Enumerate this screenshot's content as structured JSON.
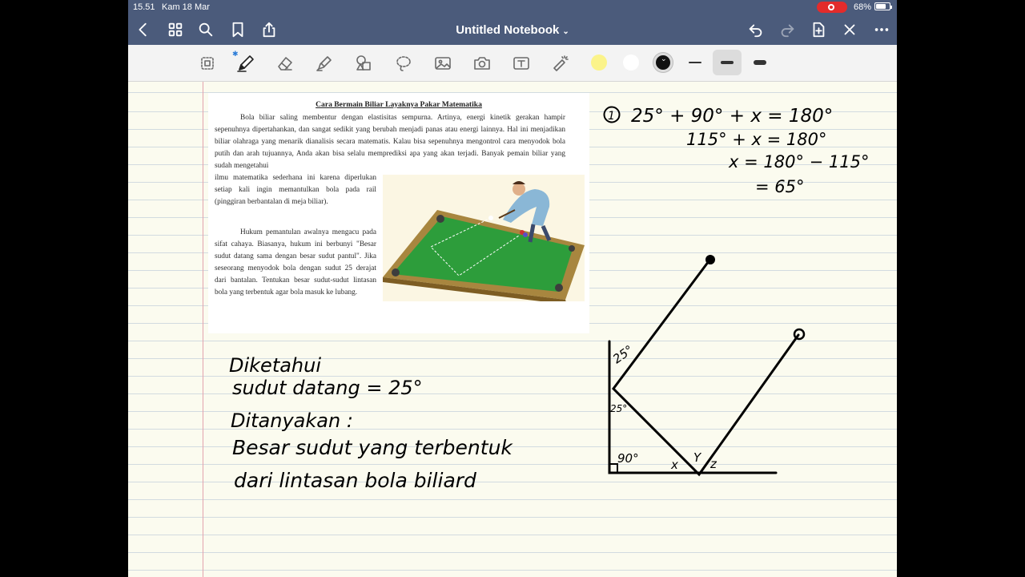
{
  "status_bar": {
    "time": "15.51",
    "date": "Kam 18 Mar",
    "battery": "68%"
  },
  "nav_bar": {
    "title": "Untitled Notebook",
    "title_chevron": "⌄"
  },
  "toolbar": {
    "tools": [
      "lasso-panel-icon",
      "pen-icon",
      "eraser-icon",
      "highlighter-icon",
      "shapes-icon",
      "lasso-icon",
      "image-icon",
      "camera-icon",
      "text-icon",
      "laser-pointer-icon"
    ],
    "colors": {
      "yellow": "#fbf38a",
      "white": "#ffffff",
      "black": "#111111"
    },
    "bluetooth": "✱"
  },
  "document_excerpt": {
    "title": "Cara Bermain Biliar Layaknya Pakar Matematika",
    "paragraph1": "Bola biliar saling membentur dengan elastisitas sempurna. Artinya, energi kinetik gerakan hampir sepenuhnya dipertahankan, dan sangat sedikit yang berubah menjadi panas atau energi lainnya. Hal ini menjadikan biliar olahraga yang menarik dianalisis secara matematis. Kalau bisa sepenuhnya mengontrol cara menyodok bola putih dan arah tujuannya, Anda akan bisa selalu memprediksi apa yang akan terjadi. Banyak pemain biliar yang sudah mengetahui",
    "paragraph2": "ilmu matematika sederhana ini karena diperlukan setiap kali ingin memantulkan bola pada rail (pinggiran berbantalan di meja biliar).",
    "paragraph3": "Hukum pemantulan awalnya mengacu pada sifat cahaya. Biasanya, hukum ini berbunyi \"Besar sudut datang sama dengan besar sudut pantul\". Jika seseorang menyodok bola dengan sudut 25 derajat dari bantalan. Tentukan besar sudut-sudut lintasan bola yang terbentuk agar bola masuk ke lubang."
  },
  "handwriting": {
    "equation_number": "1",
    "eq_line1": "25° + 90° + x = 180°",
    "eq_line2": "115° + x = 180°",
    "eq_line3": "x = 180° − 115°",
    "eq_line4": "= 65°",
    "known_label": "Diketahui",
    "known_value": "sudut datang = 25°",
    "asked_label": "Ditanyakan :",
    "asked_line1": "Besar sudut yang terbentuk",
    "asked_line2": "dari lintasan bola biliard",
    "diagram_labels": {
      "top_angle": "25°",
      "mid_angle": "25°",
      "right_angle": "90°",
      "x": "x",
      "y": "Y",
      "z": "z"
    }
  }
}
